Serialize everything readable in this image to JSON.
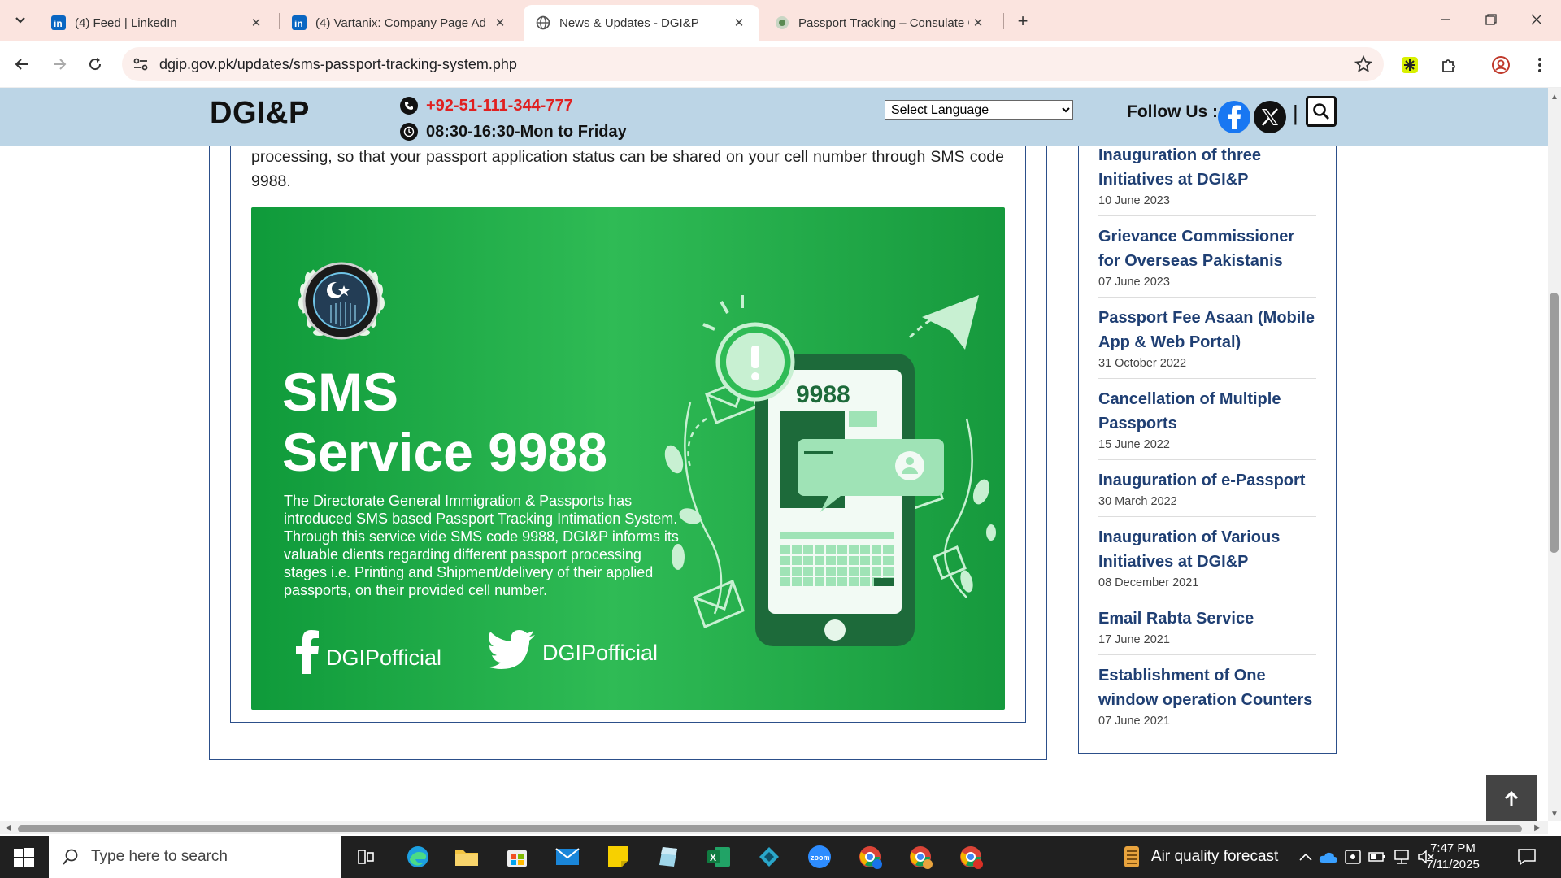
{
  "browser": {
    "tabs": [
      {
        "title": "(4) Feed | LinkedIn",
        "favicon": "linkedin-icon"
      },
      {
        "title": "(4) Vartanix: Company Page Ad",
        "favicon": "linkedin-icon"
      },
      {
        "title": "News & Updates - DGI&P",
        "favicon": "globe-icon",
        "active": true
      },
      {
        "title": "Passport Tracking – Consulate G",
        "favicon": "pakistan-emblem-icon"
      }
    ],
    "url": "dgip.gov.pk/updates/sms-passport-tracking-system.php"
  },
  "header": {
    "logo": "DGI&P",
    "phone": "+92-51-111-344-777",
    "hours": "08:30-16:30-Mon to Friday",
    "language_select": "Select Language",
    "follow_label": "Follow Us :",
    "separator": "|"
  },
  "article": {
    "text": "processing, so that your passport application status can be shared on your cell number through SMS code 9988."
  },
  "banner": {
    "title_line1": "SMS",
    "title_line2": "Service 9988",
    "description_p1": "The Directorate General Immigration & Passports has introduced SMS based Passport Tracking Intimation System.",
    "description_p2": "Through this service vide SMS code 9988, DGI&P informs its valuable clients regarding different passport processing stages i.e. Printing and Shipment/delivery of their applied passports, on their provided cell number.",
    "facebook_handle": "DGIPofficial",
    "twitter_handle": "DGIPofficial",
    "phone_code": "9988"
  },
  "sidebar": {
    "items": [
      {
        "title": "Inauguration of three Initiatives at DGI&P",
        "date": "10 June 2023"
      },
      {
        "title": "Grievance Commissioner for Overseas Pakistanis",
        "date": "07 June 2023"
      },
      {
        "title": "Passport Fee Asaan (Mobile App & Web Portal)",
        "date": "31 October 2022"
      },
      {
        "title": "Cancellation of Multiple Passports",
        "date": "15 June 2022"
      },
      {
        "title": "Inauguration of e-Passport",
        "date": "30 March 2022"
      },
      {
        "title": "Inauguration of Various Initiatives at DGI&P",
        "date": "08 December 2021"
      },
      {
        "title": "Email Rabta Service",
        "date": "17 June 2021"
      },
      {
        "title": "Establishment of One window operation Counters",
        "date": "07 June 2021"
      }
    ]
  },
  "taskbar": {
    "search_placeholder": "Type here to search",
    "weather": "Air quality forecast",
    "time": "7:47 PM",
    "date": "7/11/2025"
  }
}
